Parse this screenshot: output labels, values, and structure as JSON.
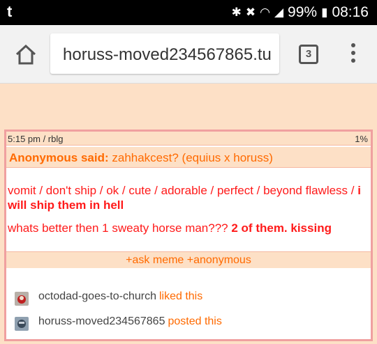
{
  "statusbar": {
    "app": "t",
    "battery": "99%",
    "time": "08:16"
  },
  "browser": {
    "url": "horuss-moved234567865.tu",
    "tab_count": "3"
  },
  "post": {
    "meta": {
      "time": "5:15 pm / rblg",
      "percent": "1%"
    },
    "ask": {
      "asker": "Anonymous said:",
      "question": "zahhakcest? (equius x horuss)"
    },
    "answer": {
      "line1_plain": "vomit / don't ship / ok / cute / adorable / perfect / beyond flawless /",
      "line1_bold": "i will ship them in hell",
      "line2_plain": "whats better then 1 sweaty horse man???",
      "line2_bold": "2 of them. kissing"
    },
    "footer": "+ask meme +anonymous",
    "notes": [
      {
        "user": "octodad-goes-to-church",
        "action": "liked this"
      },
      {
        "user": "horuss-moved234567865",
        "action": "posted this"
      }
    ]
  },
  "colors": {
    "accent": "#ff6a00",
    "red": "#ff1a1a",
    "peach": "#fde0c6",
    "border": "#f0a0a0"
  }
}
